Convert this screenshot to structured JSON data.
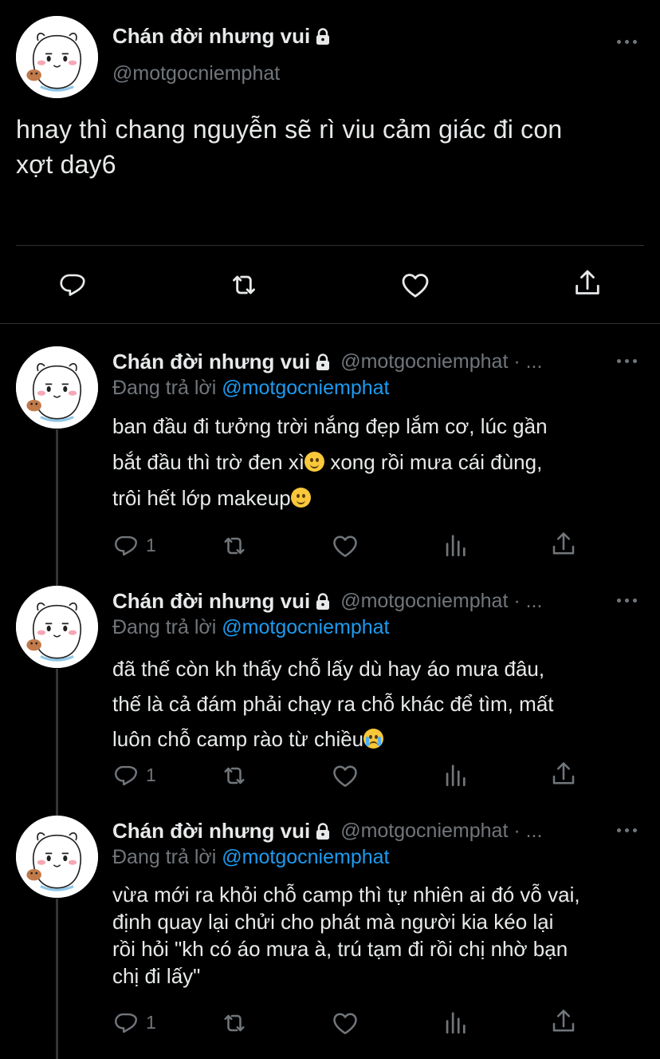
{
  "main_tweet": {
    "display_name": "Chán đời nhưng vui",
    "handle": "@motgocniemphat",
    "text_line1": "hnay thì chang nguyễn sẽ rì viu cảm giác đi con",
    "text_line2": "xợt day6"
  },
  "replies": [
    {
      "display_name": "Chán đời nhưng vui",
      "handle": "@motgocniemphat · ...",
      "replying_label": "Đang trả lời",
      "replying_to": "@motgocniemphat",
      "lines": [
        "ban đầu đi tưởng trời nắng đẹp lắm cơ, lúc gần",
        "bắt đầu thì trờ đen xì",
        " xong rồi mưa cái đùng,",
        "trôi hết lớp makeup"
      ],
      "reply_count": "1"
    },
    {
      "display_name": "Chán đời nhưng vui",
      "handle": "@motgocniemphat · ...",
      "replying_label": "Đang trả lời",
      "replying_to": "@motgocniemphat",
      "lines": [
        "đã thế còn kh thấy chỗ lấy dù hay áo mưa đâu,",
        "thế là cả đám phải chạy ra chỗ khác để tìm, mất",
        "luôn chỗ camp rào từ chiều"
      ],
      "reply_count": "1"
    },
    {
      "display_name": "Chán đời nhưng vui",
      "handle": "@motgocniemphat · ...",
      "replying_label": "Đang trả lời",
      "replying_to": "@motgocniemphat",
      "lines": [
        "vừa mới ra khỏi chỗ camp thì tự nhiên ai đó vỗ vai,",
        "định quay lại chửi cho phát mà người kia kéo lại",
        "rồi hỏi \"kh có áo mưa à, trú tạm đi rồi chị nhờ bạn",
        "chị đi lấy\""
      ],
      "reply_count": "1"
    }
  ],
  "colors": {
    "background": "#000000",
    "text": "#e7e9ea",
    "muted": "#71767b",
    "link": "#1d9bf0",
    "divider": "#2f3336"
  },
  "icons": [
    "lock-icon",
    "more-icon",
    "reply-icon",
    "retweet-icon",
    "like-icon",
    "share-icon",
    "analytics-icon",
    "emoji-slight-smile",
    "emoji-loudly-crying"
  ]
}
